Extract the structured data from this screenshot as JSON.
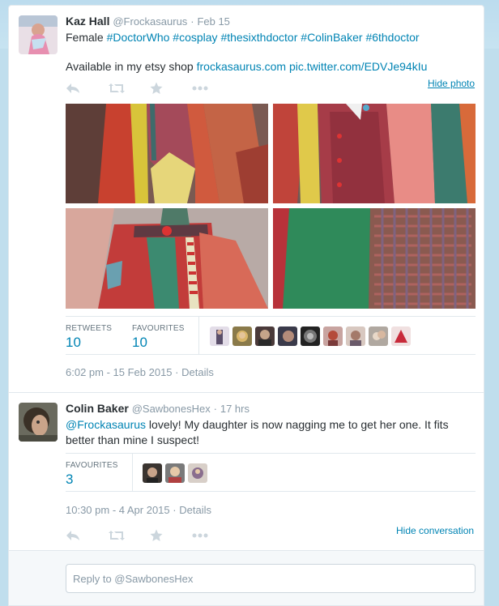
{
  "tweet": {
    "fullname": "Kaz Hall",
    "username": "@Frockasaurus",
    "dot": "·",
    "date": "Feb 15",
    "text_start": "Female ",
    "hashtags": [
      "#DoctorWho",
      "#cosplay",
      "#thesixthdoctor",
      "#ColinBaker",
      "#6thdoctor"
    ],
    "line2_prefix": "Available in my etsy shop ",
    "line2_link": "frockasaurus.com",
    "line2_pic": "pic.twitter.com/EDVJe94kIu",
    "hide_photo": "Hide photo",
    "retweets_label": "RETWEETS",
    "retweets_value": "10",
    "favourites_label": "FAVOURITES",
    "favourites_value": "10",
    "timestamp": "6:02 pm - 15 Feb 2015",
    "details": "Details"
  },
  "reply": {
    "fullname": "Colin Baker",
    "username": "@SawbonesHex",
    "dot": "·",
    "date": "17 hrs",
    "mention": "@Frockasaurus",
    "text_line1": " lovely!  My daughter is now nagging me to get her one.  It fits",
    "text_line2": "better than mine I suspect!",
    "favourites_label": "FAVOURITES",
    "favourites_value": "3",
    "timestamp": "10:30 pm - 4 Apr 2015",
    "details": "Details",
    "hide_conversation": "Hide conversation"
  },
  "reply_box": {
    "placeholder": "Reply to @SawbonesHex"
  },
  "icons": [
    "reply-icon",
    "retweet-icon",
    "favorite-icon",
    "more-icon"
  ],
  "colors": {
    "link": "#0084b4",
    "muted": "#8899a6",
    "icon": "#ccd6dd",
    "background": "#c0deed"
  }
}
